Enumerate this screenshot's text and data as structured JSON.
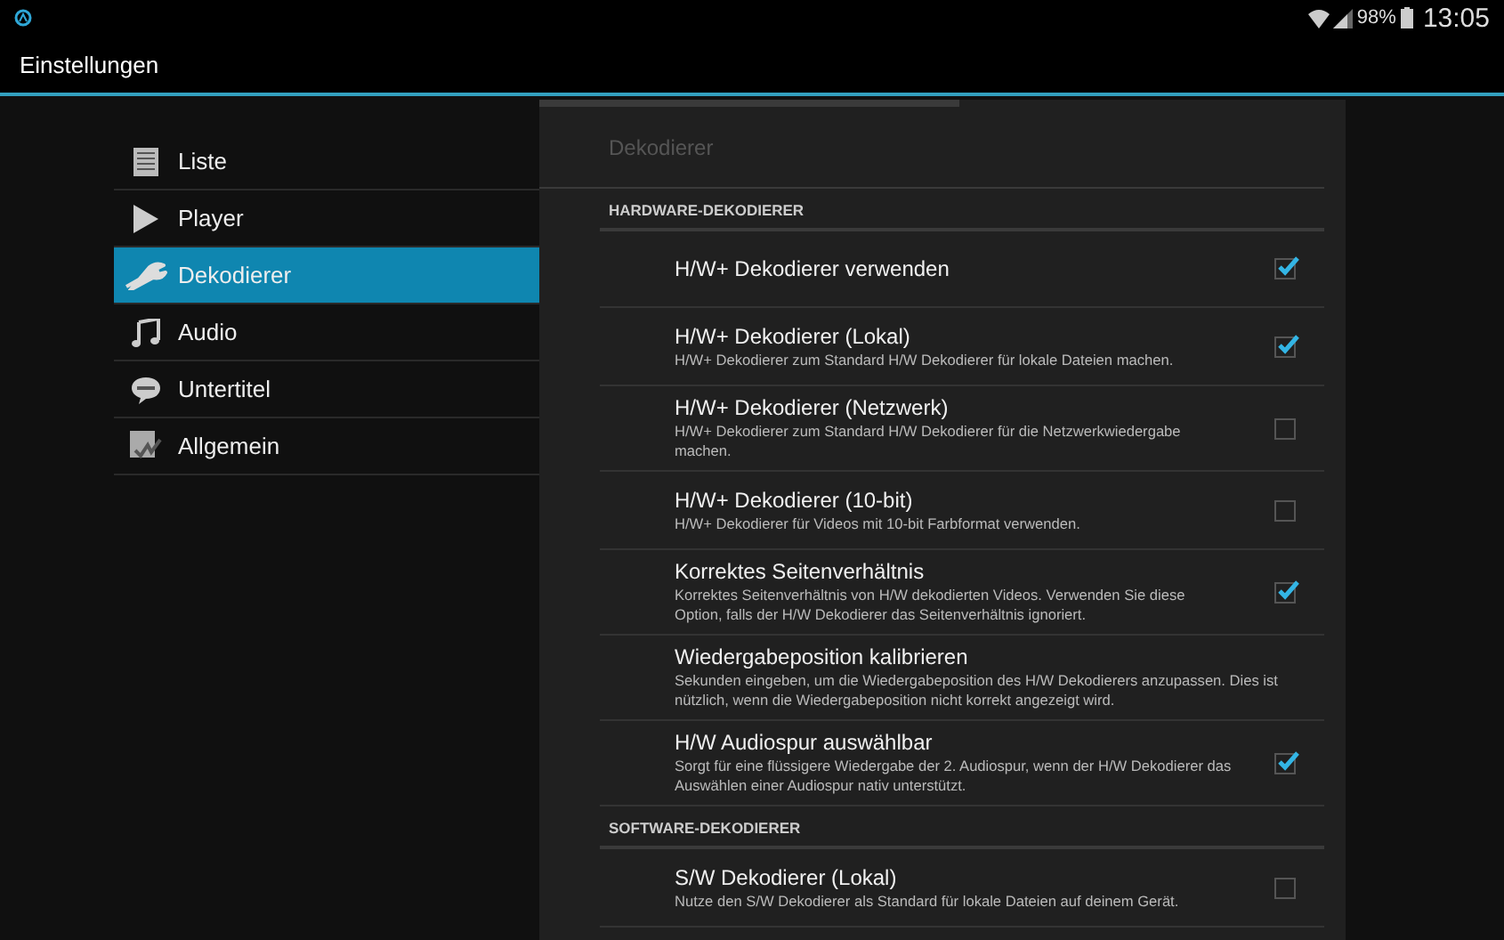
{
  "status_bar": {
    "battery": "98%",
    "time": "13:05"
  },
  "action_bar": {
    "title": "Einstellungen"
  },
  "sidebar": {
    "items": [
      {
        "label": "Liste",
        "selected": false
      },
      {
        "label": "Player",
        "selected": false
      },
      {
        "label": "Dekodierer",
        "selected": true
      },
      {
        "label": "Audio",
        "selected": false
      },
      {
        "label": "Untertitel",
        "selected": false
      },
      {
        "label": "Allgemein",
        "selected": false
      }
    ]
  },
  "panel": {
    "title": "Dekodierer",
    "sections": [
      {
        "header": "HARDWARE-DEKODIERER",
        "items": [
          {
            "kind": "checkbox",
            "title": "H/W+ Dekodierer verwenden",
            "checked": true
          },
          {
            "kind": "checkbox",
            "title": "H/W+ Dekodierer (Lokal)",
            "summary": "H/W+ Dekodierer zum Standard H/W Dekodierer für lokale Dateien machen.",
            "checked": true
          },
          {
            "kind": "checkbox",
            "title": "H/W+ Dekodierer (Netzwerk)",
            "summary": "H/W+ Dekodierer zum Standard H/W Dekodierer für die Netzwerkwiedergabe machen.",
            "checked": false
          },
          {
            "kind": "checkbox",
            "title": "H/W+ Dekodierer (10-bit)",
            "summary": "H/W+ Dekodierer für Videos mit 10-bit Farbformat verwenden.",
            "checked": false
          },
          {
            "kind": "checkbox",
            "title": "Korrektes Seitenverhältnis",
            "summary": "Korrektes Seitenverhältnis von H/W dekodierten Videos. Verwenden Sie diese Option, falls der H/W Dekodierer das Seitenverhältnis ignoriert.",
            "checked": true
          },
          {
            "kind": "plain",
            "title": "Wiedergabeposition kalibrieren",
            "summary": "Sekunden eingeben, um die Wiedergabeposition des H/W Dekodierers anzupassen. Dies ist nützlich, wenn die Wiedergabeposition nicht korrekt angezeigt wird."
          },
          {
            "kind": "checkbox",
            "title": "H/W Audiospur auswählbar",
            "summary": "Sorgt für eine flüssigere Wiedergabe der 2. Audiospur, wenn der H/W Dekodierer das Auswählen einer Audiospur nativ unterstützt.",
            "checked": true
          }
        ]
      },
      {
        "header": "SOFTWARE-DEKODIERER",
        "items": [
          {
            "kind": "checkbox",
            "title": "S/W Dekodierer (Lokal)",
            "summary": "Nutze den S/W Dekodierer als Standard für lokale Dateien auf deinem Gerät.",
            "checked": false
          }
        ]
      }
    ]
  }
}
